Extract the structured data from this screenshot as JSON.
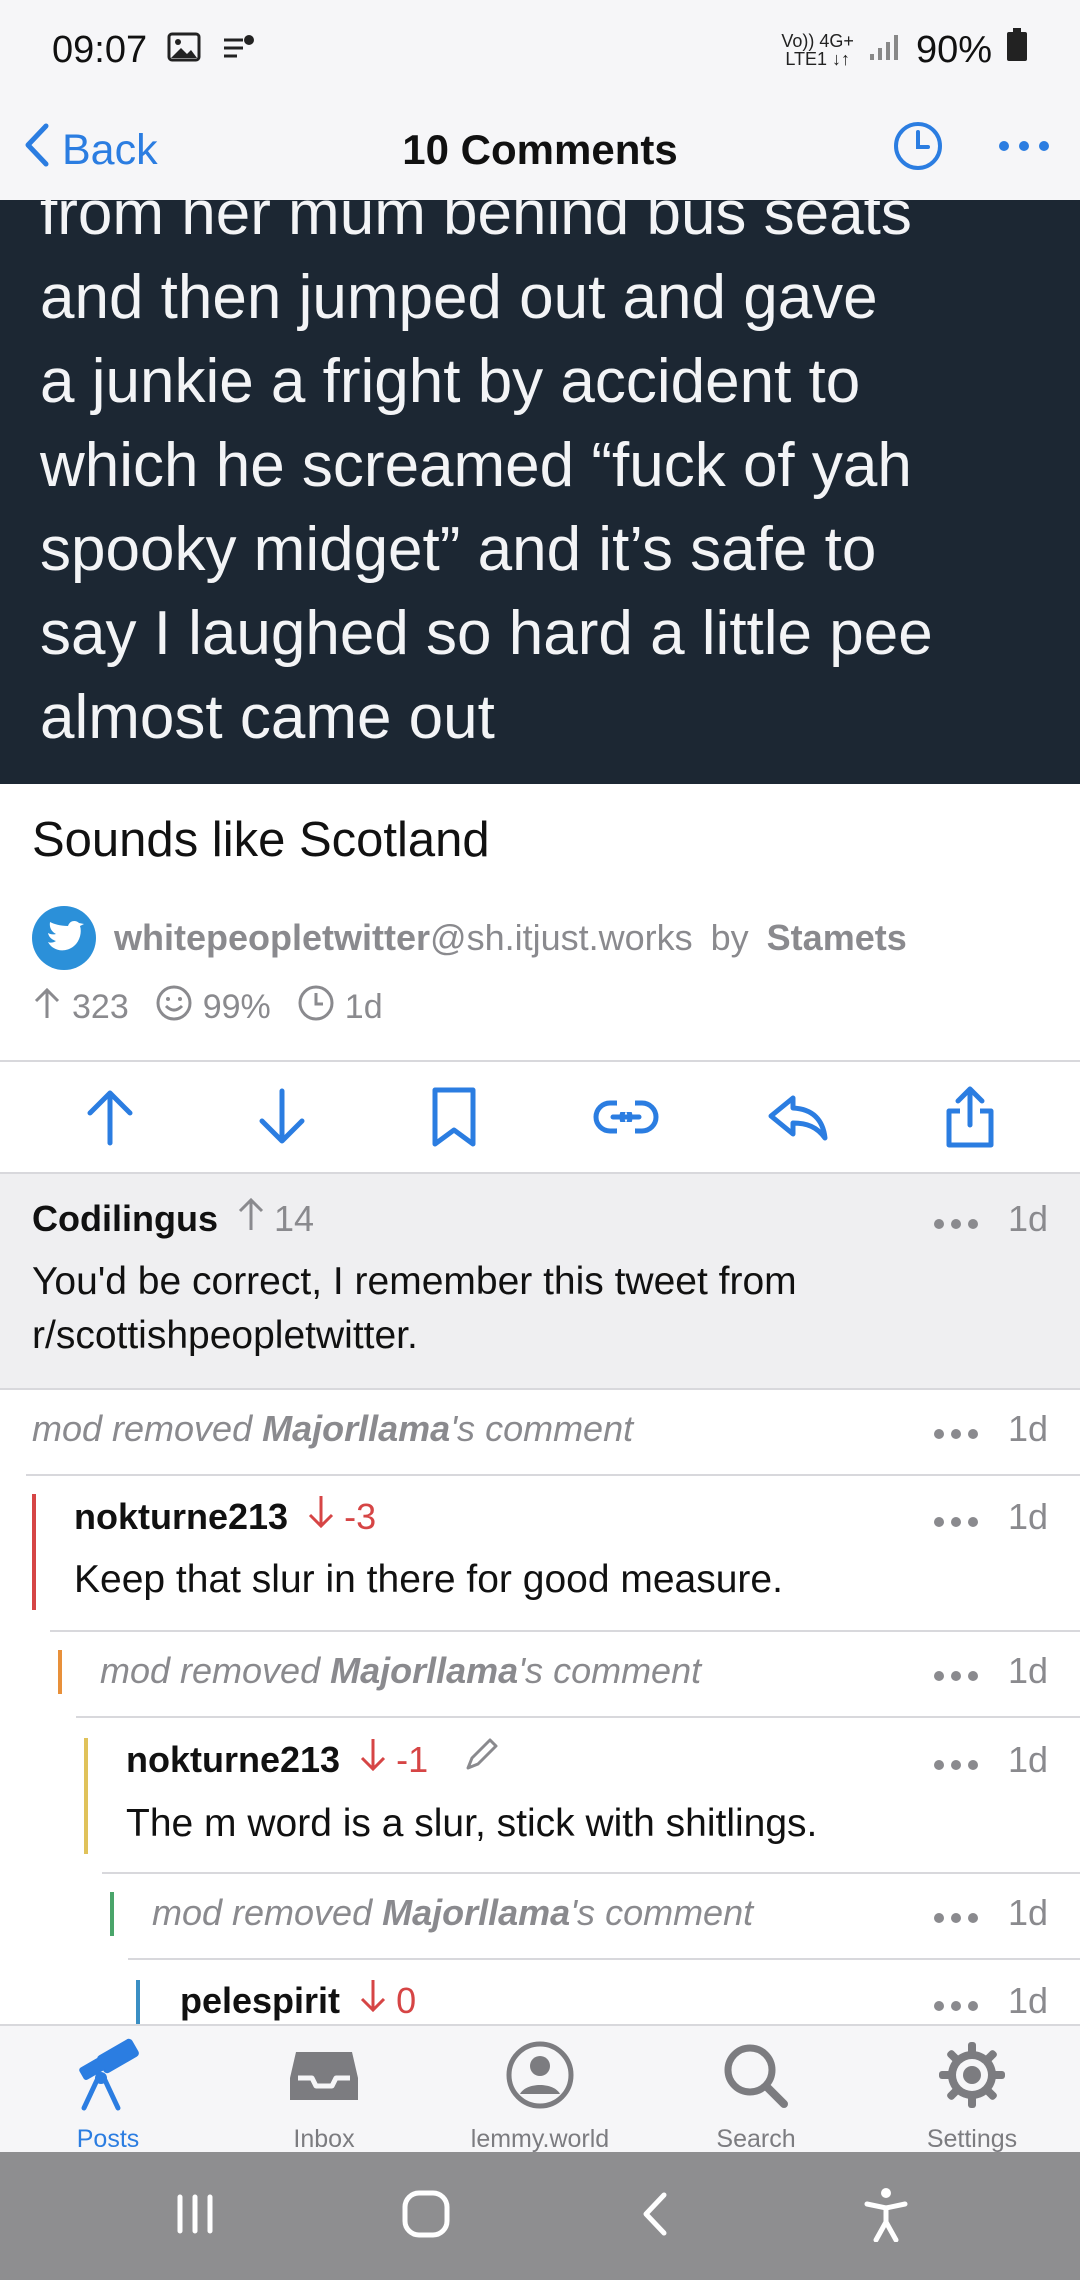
{
  "status_bar": {
    "time": "09:07",
    "network_top": "Vo)) 4G+",
    "network_bottom": "LTE1 ↓↑",
    "battery": "90%"
  },
  "nav": {
    "back_label": "Back",
    "title": "10 Comments"
  },
  "tweet_lines": [
    "from her mum behind bus seats",
    "and then jumped out and gave",
    "a junkie a fright by accident to",
    "which he screamed “fuck of yah",
    "spooky midget” and it’s safe to",
    "say I laughed so hard a little pee",
    "almost came out"
  ],
  "post": {
    "title": "Sounds like Scotland",
    "community": "whitepeopletwitter",
    "instance": "@sh.itjust.works",
    "by": "by",
    "author": "Stamets",
    "score": "323",
    "upvote_pct": "99%",
    "age": "1d"
  },
  "comments": {
    "c1": {
      "author": "Codilingus",
      "score": "14",
      "age": "1d",
      "body1": "You'd be correct, I remember this tweet from",
      "body2": "r/scottishpeopletwitter."
    },
    "r1": {
      "prefix": "mod removed ",
      "user": "Majorllama",
      "suffix": "'s comment",
      "age": "1d"
    },
    "c2": {
      "author": "nokturne213",
      "score": "-3",
      "age": "1d",
      "body": "Keep that slur in there for good measure."
    },
    "r2": {
      "prefix": "mod removed ",
      "user": "Majorllama",
      "suffix": "'s comment",
      "age": "1d"
    },
    "c3": {
      "author": "nokturne213",
      "score": "-1",
      "age": "1d",
      "body": "The m word is a slur, stick with shitlings."
    },
    "r3": {
      "prefix": "mod removed ",
      "user": "Majorllama",
      "suffix": "'s comment",
      "age": "1d"
    },
    "c4": {
      "author": "pelespirit",
      "score": "0",
      "age": "1d"
    }
  },
  "tabs": [
    {
      "label": "Posts",
      "icon": "telescope-icon"
    },
    {
      "label": "Inbox",
      "icon": "inbox-icon"
    },
    {
      "label": "lemmy.world",
      "icon": "account-icon"
    },
    {
      "label": "Search",
      "icon": "search-icon"
    },
    {
      "label": "Settings",
      "icon": "gear-icon"
    }
  ],
  "colors": {
    "accent": "#2b7de1",
    "downvote": "#d64545",
    "tweet_bg": "#1c2733"
  }
}
